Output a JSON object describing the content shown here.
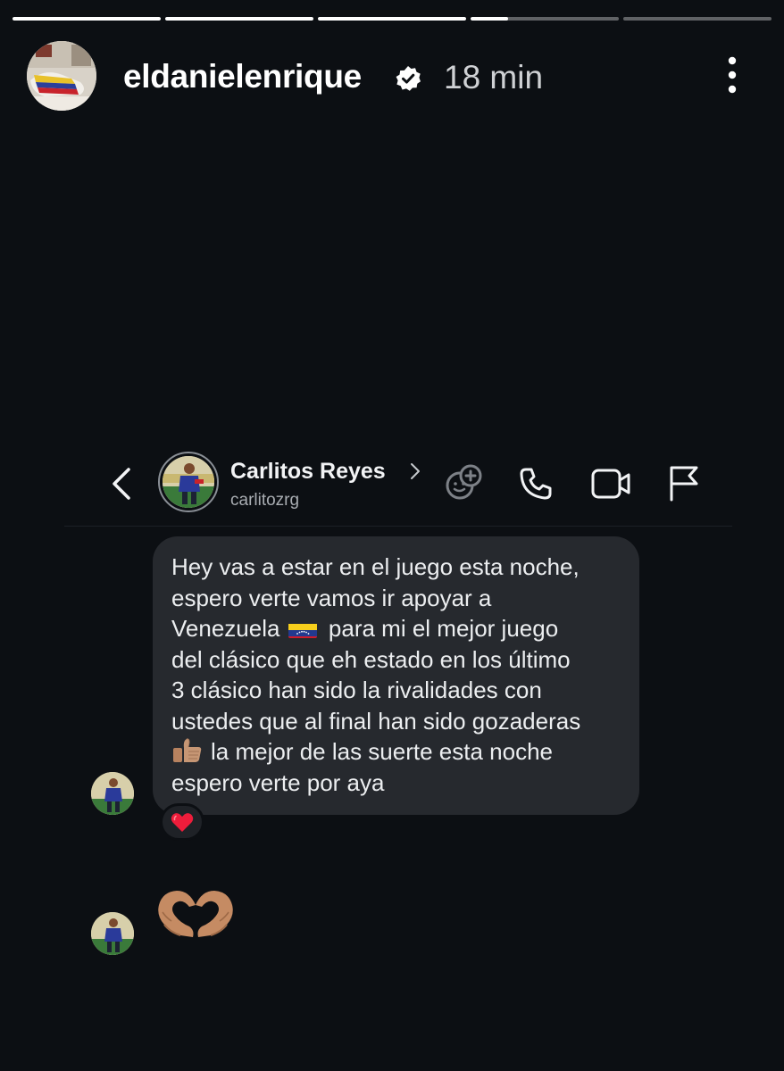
{
  "story": {
    "progress": [
      1,
      1,
      1,
      0.25,
      0
    ],
    "username": "eldanielenrique",
    "verified": true,
    "time": "18 min",
    "icons": {
      "verified": "verified-badge-icon",
      "more": "more-vertical-icon"
    }
  },
  "dm": {
    "contact_name": "Carlitos Reyes",
    "contact_handle": "carlitozrg",
    "icons": {
      "back": "back-chevron-icon",
      "chevron": "chevron-right-icon",
      "avatar_sticker": "add-sticker-icon",
      "call": "phone-icon",
      "video": "video-camera-icon",
      "flag": "flag-icon"
    }
  },
  "messages": [
    {
      "lines": [
        "Hey vas a estar en el juego esta noche,",
        "espero verte vamos ir apoyar a",
        "Venezuela",
        "para mi el mejor juego",
        "del clásico que eh estado en los último",
        "3 clásico han sido la rivalidades con",
        "ustedes que al final han sido gozaderas",
        "la mejor de las suerte esta noche",
        "espero verte por aya"
      ],
      "emojis": [
        "venezuela-flag",
        "thumbs-up-medium-skin"
      ],
      "reaction": "red-heart"
    },
    {
      "emoji": "heart-hands-medium-skin"
    }
  ],
  "colors": {
    "background": "#0c0f13",
    "bubble": "#26292e",
    "text": "#eceef0"
  }
}
